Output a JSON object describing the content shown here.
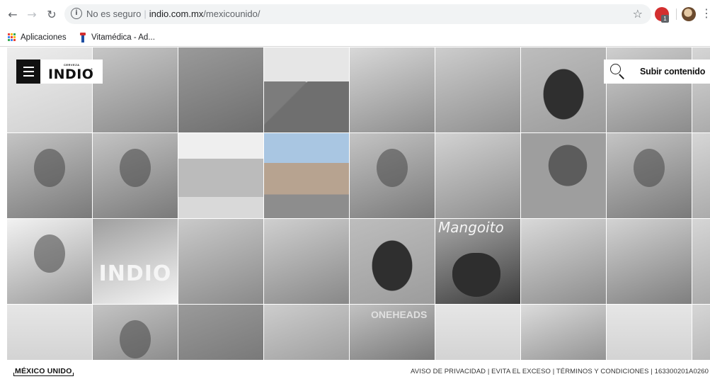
{
  "browser": {
    "security_label": "No es seguro",
    "url_host": "indio.com.mx",
    "url_path": "/mexicounido/",
    "bookmarks": [
      {
        "label": "Aplicaciones",
        "icon": "apps-grid-icon"
      },
      {
        "label": "Vitamédica - Ad...",
        "icon": "vitamedica-icon"
      }
    ],
    "extension_badge": "1"
  },
  "site": {
    "logo_small": "CERVEZA",
    "logo_main": "INDIO",
    "logo_mark": "®",
    "upload_label": "Subir contenido"
  },
  "gallery": {
    "tiles": [
      {
        "label": "",
        "kind": "figure"
      },
      {
        "label": "",
        "kind": "car"
      },
      {
        "label": "",
        "kind": "dark"
      },
      {
        "label": "",
        "kind": "mountain"
      },
      {
        "label": "",
        "kind": "kiosk"
      },
      {
        "label": "",
        "kind": "crowd"
      },
      {
        "label": "",
        "kind": "dog"
      },
      {
        "label": "",
        "kind": "street"
      },
      {
        "label": "",
        "kind": "edge"
      },
      {
        "label": "",
        "kind": "portrait"
      },
      {
        "label": "",
        "kind": "portrait"
      },
      {
        "label": "",
        "kind": "pyramid"
      },
      {
        "label": "",
        "kind": "island"
      },
      {
        "label": "",
        "kind": "portrait"
      },
      {
        "label": "",
        "kind": "food"
      },
      {
        "label": "",
        "kind": "balloon"
      },
      {
        "label": "",
        "kind": "portrait"
      },
      {
        "label": "",
        "kind": "edge"
      },
      {
        "label": "",
        "kind": "person"
      },
      {
        "label": "INDIO",
        "kind": "indio"
      },
      {
        "label": "",
        "kind": "landscape"
      },
      {
        "label": "",
        "kind": "ruins"
      },
      {
        "label": "",
        "kind": "dog"
      },
      {
        "label": "Mangoito",
        "kind": "mango"
      },
      {
        "label": "",
        "kind": "boardwalk"
      },
      {
        "label": "",
        "kind": "waterfall"
      },
      {
        "label": "",
        "kind": "edge"
      },
      {
        "label": "",
        "kind": "sky"
      },
      {
        "label": "",
        "kind": "portrait"
      },
      {
        "label": "",
        "kind": "dark"
      },
      {
        "label": "",
        "kind": "crowd"
      },
      {
        "label": "ONEHEADS",
        "kind": "group"
      },
      {
        "label": "",
        "kind": "sky"
      },
      {
        "label": "",
        "kind": "plane"
      },
      {
        "label": "",
        "kind": "sky"
      },
      {
        "label": "",
        "kind": "edge"
      }
    ]
  },
  "footer": {
    "logo": "MÉXICO UNIDO",
    "links": "AVISO DE PRIVACIDAD | EVITA EL EXCESO | TÉRMINOS Y CONDICIONES | 163300201A0260"
  }
}
